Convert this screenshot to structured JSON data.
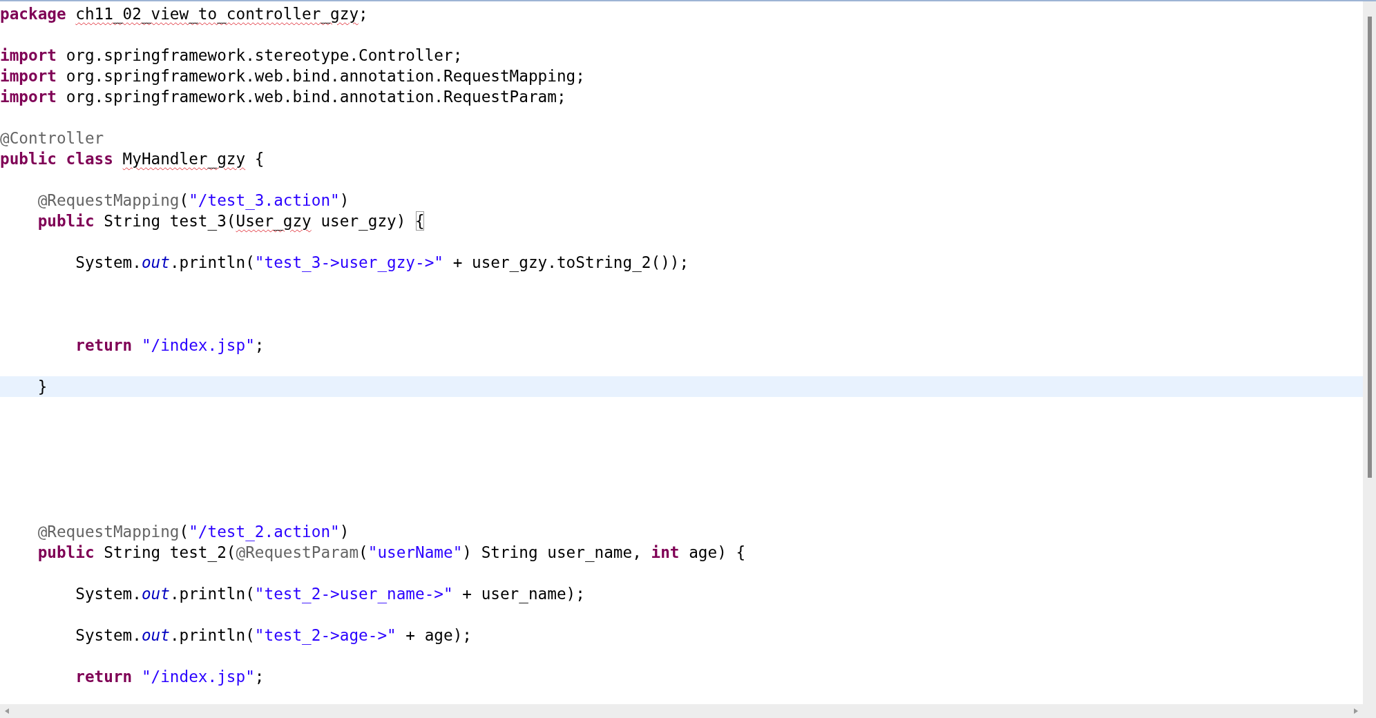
{
  "editor": {
    "lines": [
      {
        "kind": "code",
        "current": false,
        "tokens": [
          {
            "kind": "keyword",
            "text": "package "
          },
          {
            "kind": "squiggle",
            "text": "ch11_02_view_to_controller_gzy"
          },
          {
            "kind": "plain",
            "text": ";"
          }
        ]
      },
      {
        "kind": "blank",
        "current": false
      },
      {
        "kind": "code",
        "current": false,
        "tokens": [
          {
            "kind": "keyword",
            "text": "import"
          },
          {
            "kind": "plain",
            "text": " org.springframework.stereotype.Controller;"
          }
        ]
      },
      {
        "kind": "code",
        "current": false,
        "tokens": [
          {
            "kind": "keyword",
            "text": "import"
          },
          {
            "kind": "plain",
            "text": " org.springframework.web.bind.annotation.RequestMapping;"
          }
        ]
      },
      {
        "kind": "code",
        "current": false,
        "tokens": [
          {
            "kind": "keyword",
            "text": "import"
          },
          {
            "kind": "plain",
            "text": " org.springframework.web.bind.annotation.RequestParam;"
          }
        ]
      },
      {
        "kind": "blank",
        "current": false
      },
      {
        "kind": "code",
        "current": false,
        "tokens": [
          {
            "kind": "annotation",
            "text": "@Controller"
          }
        ]
      },
      {
        "kind": "code",
        "current": false,
        "tokens": [
          {
            "kind": "keyword",
            "text": "public class "
          },
          {
            "kind": "squiggle",
            "text": "MyHandler_gzy"
          },
          {
            "kind": "plain",
            "text": " {"
          }
        ]
      },
      {
        "kind": "blank",
        "current": false
      },
      {
        "kind": "code",
        "current": false,
        "tokens": [
          {
            "kind": "annotation",
            "text": "    @RequestMapping"
          },
          {
            "kind": "plain",
            "text": "("
          },
          {
            "kind": "string",
            "text": "\"/test_3.action\""
          },
          {
            "kind": "plain",
            "text": ")"
          }
        ]
      },
      {
        "kind": "code",
        "current": false,
        "tokens": [
          {
            "kind": "keyword",
            "text": "    public"
          },
          {
            "kind": "plain",
            "text": " String test_3("
          },
          {
            "kind": "squiggle",
            "text": "User_gzy"
          },
          {
            "kind": "plain",
            "text": " user_gzy) "
          },
          {
            "kind": "bracket-match",
            "text": "{"
          }
        ]
      },
      {
        "kind": "blank",
        "current": false
      },
      {
        "kind": "code",
        "current": false,
        "tokens": [
          {
            "kind": "plain",
            "text": "        System."
          },
          {
            "kind": "static",
            "text": "out"
          },
          {
            "kind": "plain",
            "text": ".println("
          },
          {
            "kind": "string",
            "text": "\"test_3->user_gzy->\""
          },
          {
            "kind": "plain",
            "text": " + user_gzy.toString_2());"
          }
        ]
      },
      {
        "kind": "blank",
        "current": false
      },
      {
        "kind": "blank",
        "current": false
      },
      {
        "kind": "blank",
        "current": false
      },
      {
        "kind": "code",
        "current": false,
        "tokens": [
          {
            "kind": "keyword",
            "text": "        return "
          },
          {
            "kind": "string",
            "text": "\"/index.jsp\""
          },
          {
            "kind": "plain",
            "text": ";"
          }
        ]
      },
      {
        "kind": "blank",
        "current": false
      },
      {
        "kind": "code",
        "current": true,
        "tokens": [
          {
            "kind": "plain",
            "text": "    }"
          }
        ]
      },
      {
        "kind": "blank",
        "current": false
      },
      {
        "kind": "blank",
        "current": false
      },
      {
        "kind": "blank",
        "current": false
      },
      {
        "kind": "blank",
        "current": false
      },
      {
        "kind": "blank",
        "current": false
      },
      {
        "kind": "blank",
        "current": false
      },
      {
        "kind": "code",
        "current": false,
        "tokens": [
          {
            "kind": "annotation",
            "text": "    @RequestMapping"
          },
          {
            "kind": "plain",
            "text": "("
          },
          {
            "kind": "string",
            "text": "\"/test_2.action\""
          },
          {
            "kind": "plain",
            "text": ")"
          }
        ]
      },
      {
        "kind": "code",
        "current": false,
        "tokens": [
          {
            "kind": "keyword",
            "text": "    public"
          },
          {
            "kind": "plain",
            "text": " String test_2("
          },
          {
            "kind": "annotation",
            "text": "@RequestParam"
          },
          {
            "kind": "plain",
            "text": "("
          },
          {
            "kind": "string",
            "text": "\"userName\""
          },
          {
            "kind": "plain",
            "text": ") String user_name, "
          },
          {
            "kind": "keyword",
            "text": "int"
          },
          {
            "kind": "plain",
            "text": " age) {"
          }
        ]
      },
      {
        "kind": "blank",
        "current": false
      },
      {
        "kind": "code",
        "current": false,
        "tokens": [
          {
            "kind": "plain",
            "text": "        System."
          },
          {
            "kind": "static",
            "text": "out"
          },
          {
            "kind": "plain",
            "text": ".println("
          },
          {
            "kind": "string",
            "text": "\"test_2->user_name->\""
          },
          {
            "kind": "plain",
            "text": " + user_name);"
          }
        ]
      },
      {
        "kind": "blank",
        "current": false
      },
      {
        "kind": "code",
        "current": false,
        "tokens": [
          {
            "kind": "plain",
            "text": "        System."
          },
          {
            "kind": "static",
            "text": "out"
          },
          {
            "kind": "plain",
            "text": ".println("
          },
          {
            "kind": "string",
            "text": "\"test_2->age->\""
          },
          {
            "kind": "plain",
            "text": " + age);"
          }
        ]
      },
      {
        "kind": "blank",
        "current": false
      },
      {
        "kind": "code",
        "current": false,
        "tokens": [
          {
            "kind": "keyword",
            "text": "        return "
          },
          {
            "kind": "string",
            "text": "\"/index.jsp\""
          },
          {
            "kind": "plain",
            "text": ";"
          }
        ]
      }
    ]
  }
}
